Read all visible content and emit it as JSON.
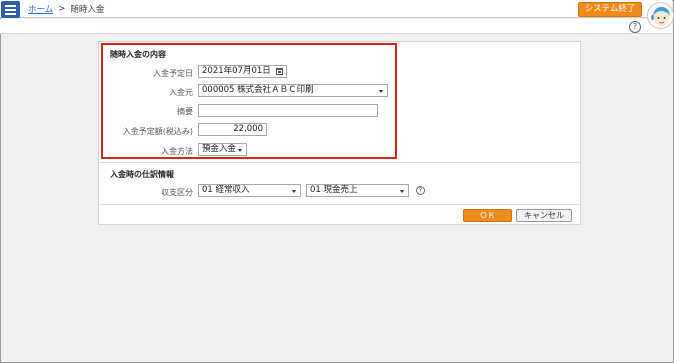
{
  "header": {
    "breadcrumb_home": "ホーム",
    "breadcrumb_sep": ">",
    "breadcrumb_current": "随時入金",
    "system_exit_label": "システム終了",
    "help_label": "?"
  },
  "form": {
    "section_title": "随時入金の内容",
    "scheduled_date_label": "入金予定日",
    "scheduled_date_value": "2021年07月01日",
    "payer_label": "入金元",
    "payer_value": "000005 株式会社ＡＢＣ印刷",
    "summary_label": "摘要",
    "summary_value": "",
    "amount_label": "入金予定額(税込み)",
    "amount_value": "22,000",
    "method_label": "入金方法",
    "method_value": "預金入金"
  },
  "journal": {
    "section_title": "入金時の仕訳情報",
    "category_label": "収支区分",
    "category_value_1": "01 経常収入",
    "category_value_2": "01 現金売上",
    "help_label": "?"
  },
  "buttons": {
    "ok_label": "ＯＫ",
    "cancel_label": "キャンセル"
  },
  "colors": {
    "accent_orange": "#f08a1c",
    "menu_blue": "#2f5fa8",
    "highlight_red": "#e0211a",
    "link_blue": "#2a6fd6"
  }
}
